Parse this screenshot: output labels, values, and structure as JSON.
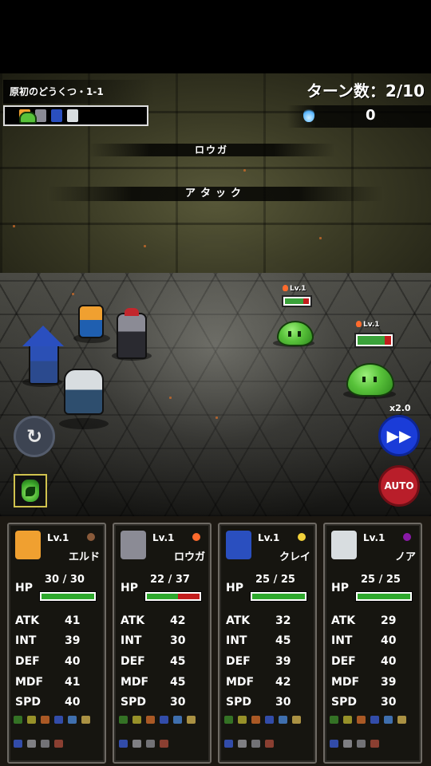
{
  "stage": {
    "name": "原初のどうくつ・1-1"
  },
  "turn": {
    "text": "ターン数：2/10"
  },
  "souls": {
    "value": "0"
  },
  "battle": {
    "actor_name": "ロウガ",
    "action_name": "アタック"
  },
  "enemies": [
    {
      "level": "Lv.1",
      "hp_fraction": 0.75
    },
    {
      "level": "Lv.1",
      "hp_fraction": 0.8
    }
  ],
  "controls": {
    "speed": "x2.0",
    "auto": "AUTO",
    "restart_icon": "refresh-icon",
    "fast_forward_icon": "fast-forward-icon",
    "potion_icon": "green-potion-icon"
  },
  "party": [
    {
      "level": "Lv.1",
      "name": "エルド",
      "element": "earth",
      "element_color": "#8a5a3a",
      "portrait_color": "#f0a030",
      "hp": "30 / 30",
      "hp_fraction": 1.0,
      "stats": [
        {
          "k": "ATK",
          "v": "41"
        },
        {
          "k": "INT",
          "v": "39"
        },
        {
          "k": "DEF",
          "v": "40"
        },
        {
          "k": "MDF",
          "v": "41"
        },
        {
          "k": "SPD",
          "v": "40"
        }
      ]
    },
    {
      "level": "Lv.1",
      "name": "ロウガ",
      "element": "fire",
      "element_color": "#ff6b2d",
      "portrait_color": "#8b8b95",
      "hp": "22 / 37",
      "hp_fraction": 0.595,
      "stats": [
        {
          "k": "ATK",
          "v": "42"
        },
        {
          "k": "INT",
          "v": "30"
        },
        {
          "k": "DEF",
          "v": "45"
        },
        {
          "k": "MDF",
          "v": "45"
        },
        {
          "k": "SPD",
          "v": "30"
        }
      ]
    },
    {
      "level": "Lv.1",
      "name": "クレイ",
      "element": "thunder",
      "element_color": "#f2d13a",
      "portrait_color": "#2a4fbf",
      "hp": "25 / 25",
      "hp_fraction": 1.0,
      "stats": [
        {
          "k": "ATK",
          "v": "32"
        },
        {
          "k": "INT",
          "v": "45"
        },
        {
          "k": "DEF",
          "v": "39"
        },
        {
          "k": "MDF",
          "v": "42"
        },
        {
          "k": "SPD",
          "v": "30"
        }
      ]
    },
    {
      "level": "Lv.1",
      "name": "ノア",
      "element": "dark",
      "element_color": "#8a1aa8",
      "portrait_color": "#d8dde0",
      "hp": "25 / 25",
      "hp_fraction": 1.0,
      "stats": [
        {
          "k": "ATK",
          "v": "29"
        },
        {
          "k": "INT",
          "v": "40"
        },
        {
          "k": "DEF",
          "v": "40"
        },
        {
          "k": "MDF",
          "v": "39"
        },
        {
          "k": "SPD",
          "v": "30"
        }
      ]
    }
  ],
  "resist_icons_row1": [
    "poison-icon",
    "lightning-icon",
    "fire-icon",
    "water-icon",
    "wind-icon",
    "ring-icon"
  ],
  "resist_icons_row2": [
    "shield-icon",
    "gear-icon",
    "cross-icon",
    "skull-icon"
  ]
}
